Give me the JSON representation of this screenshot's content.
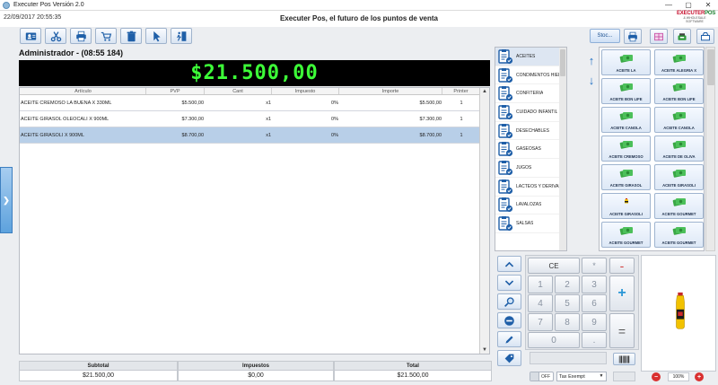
{
  "window": {
    "title": "Executer Pos Versión 2.0"
  },
  "header": {
    "datetime": "22/09/2017 20:55:35",
    "slogan": "Executer Pos, el futuro de los puntos de venta",
    "logo_text": "EXECUTERPOS",
    "logo_sub": "& WHOLESALE SOFTWARE"
  },
  "toolbar": {
    "buttons": [
      "contact-card-icon",
      "scissors-icon",
      "printer-icon",
      "cart-icon",
      "trash-icon",
      "pointer-icon",
      "door-exit-icon"
    ],
    "stock_label": "Stoc...",
    "right_buttons": [
      "printer-icon",
      "grid-icon",
      "cash-register-icon",
      "box-icon"
    ]
  },
  "session": {
    "user_label": "Administrador - (08:55 184)"
  },
  "total_display": "$21.500,00",
  "table": {
    "columns": [
      "Artículo",
      "PVP",
      "Cant",
      "Impuesto",
      "Importe",
      "Printer"
    ],
    "rows": [
      {
        "articulo": "ACEITE CREMOSO LA BUENA X 330ML",
        "pvp": "$5.500,00",
        "cant": "x1",
        "impuesto": "0%",
        "importe": "$5.500,00",
        "printer": "1",
        "selected": false
      },
      {
        "articulo": "ACEITE GIRASOL OLEOCALI X 900ML",
        "pvp": "$7.300,00",
        "cant": "x1",
        "impuesto": "0%",
        "importe": "$7.300,00",
        "printer": "1",
        "selected": false
      },
      {
        "articulo": "ACEITE GIRASOLI X 900ML",
        "pvp": "$8.700,00",
        "cant": "x1",
        "impuesto": "0%",
        "importe": "$8.700,00",
        "printer": "1",
        "selected": true
      }
    ]
  },
  "summary": {
    "subtotal_label": "Subtotal",
    "subtotal_value": "$21.500,00",
    "impuestos_label": "Impuestos",
    "impuestos_value": "$0,00",
    "total_label": "Total",
    "total_value": "$21.500,00"
  },
  "categories": [
    "ACEITES",
    "CONDIMENTOS HIERBA",
    "CONFITERIA",
    "CUIDADO INFANTIL",
    "DESECHABLES",
    "GASEOSAS",
    "JUGOS",
    "LACTEOS Y DERIVADOS",
    "LAVALOZAS",
    "SALSAS"
  ],
  "products": [
    {
      "label": "ACEITE LA",
      "img": "green"
    },
    {
      "label": "ACEITE ALEGRIA X",
      "img": "green"
    },
    {
      "label": "ACEITE BON LIFE",
      "img": "green"
    },
    {
      "label": "ACEITE BON LIFE",
      "img": "green"
    },
    {
      "label": "ACEITE CANOLA",
      "img": "green"
    },
    {
      "label": "ACEITE CANOLA",
      "img": "green"
    },
    {
      "label": "ACEITE CREMOSO",
      "img": "green"
    },
    {
      "label": "ACEITE DE OLIVA",
      "img": "green"
    },
    {
      "label": "ACEITE GIRASOL",
      "img": "green"
    },
    {
      "label": "ACEITE GIRASOLI",
      "img": "green"
    },
    {
      "label": "ACEITE GIRASOLI",
      "img": "bottle"
    },
    {
      "label": "ACEITE GOURMET",
      "img": "green"
    },
    {
      "label": "ACEITE GOURMET",
      "img": "green"
    },
    {
      "label": "ACEITE GOURMET",
      "img": "green"
    }
  ],
  "keypad": {
    "keys": [
      "CE",
      "*",
      "-",
      "1",
      "2",
      "3",
      "4",
      "5",
      "6",
      "7",
      "8",
      "9",
      "0",
      ".",
      "+",
      "="
    ]
  },
  "footer": {
    "toggle_label": "OFF",
    "tax_select": "Tax Exempt",
    "zoom": "100%"
  }
}
